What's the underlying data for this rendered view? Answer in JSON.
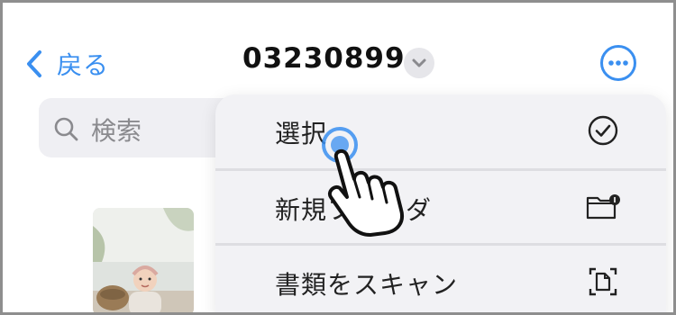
{
  "colors": {
    "accent": "#3a8ff0",
    "text": "#222222",
    "muted": "#8a8a8e"
  },
  "header": {
    "back_label": "戻る",
    "title": "03230899",
    "icons": {
      "back": "chevron-left-icon",
      "title_dropdown": "chevron-down-icon",
      "more": "ellipsis-circle-icon"
    }
  },
  "search": {
    "placeholder": "検索",
    "icon": "search-icon"
  },
  "menu": {
    "items": [
      {
        "label": "選択",
        "icon": "checkmark-circle-icon"
      },
      {
        "label": "新規フォルダ",
        "icon": "folder-badge-icon"
      },
      {
        "label": "書類をスキャン",
        "icon": "document-scan-icon"
      }
    ]
  },
  "overlay": {
    "icon": "tap-hand-pointer-icon"
  }
}
